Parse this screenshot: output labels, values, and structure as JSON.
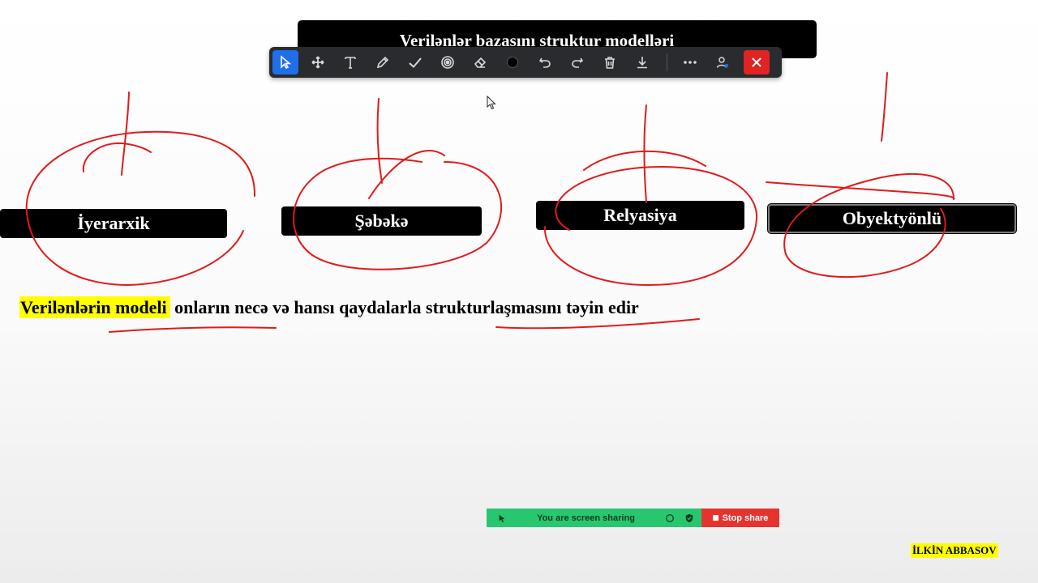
{
  "slide": {
    "title": "Verilənlər bazasını struktur  modelləri",
    "categories": [
      "İyerarxik",
      "Şəbəkə",
      "Relyasiya",
      "Obyektyönlü"
    ],
    "definition": {
      "highlighted": "Verilənlərin modeli",
      "rest": " onların necə və hansı qaydalarla strukturlaşmasını təyin edir"
    },
    "author": "İLKİN ABBASOV",
    "highlight_color": "#ffff00",
    "ink_color": "#e01b1b"
  },
  "annotation_toolbar": {
    "tools": [
      "select-icon",
      "move-icon",
      "text-icon",
      "pen-icon",
      "checkmark-icon",
      "spotlight-icon",
      "eraser-icon",
      "color-icon",
      "undo-icon",
      "redo-icon",
      "trash-icon",
      "download-icon"
    ],
    "extra": [
      "more-icon",
      "participant-icon",
      "close-icon"
    ],
    "active_tool": "select-icon"
  },
  "share_bar": {
    "message": "You are screen sharing",
    "stop_label": "Stop share"
  }
}
